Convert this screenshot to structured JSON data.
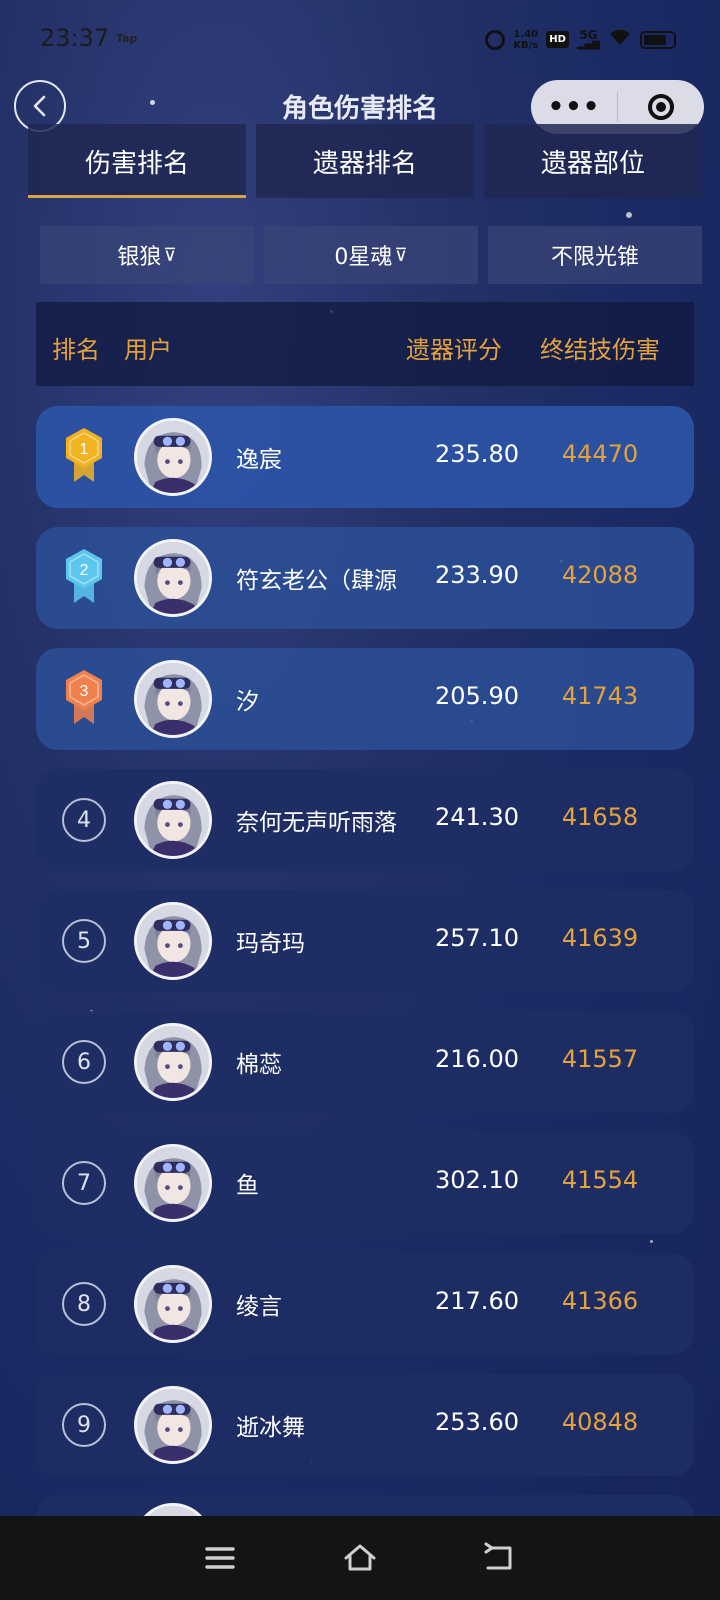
{
  "status_bar": {
    "time": "23:37",
    "tap_label": "Tap",
    "speed_value": "1.40",
    "speed_unit": "KB/s",
    "hd_label": "HD",
    "network_label": "5G"
  },
  "header": {
    "title": "角色伤害排名",
    "capsule_more": "•••"
  },
  "tabs": [
    {
      "label": "伤害排名",
      "active": true
    },
    {
      "label": "遗器排名",
      "active": false
    },
    {
      "label": "遗器部位",
      "active": false
    }
  ],
  "filters": {
    "character": "银狼",
    "eidolon": "0星魂",
    "lightcone": "不限光锥",
    "funnel_glyph": "⊽"
  },
  "table_header": {
    "rank": "排名",
    "user": "用户",
    "relic_score": "遗器评分",
    "ult_damage": "终结技伤害"
  },
  "rows": [
    {
      "rank": "1",
      "name": "逸宸",
      "score": "235.80",
      "damage": "44470"
    },
    {
      "rank": "2",
      "name": "符玄老公（肆源",
      "score": "233.90",
      "damage": "42088"
    },
    {
      "rank": "3",
      "name": "汐",
      "score": "205.90",
      "damage": "41743"
    },
    {
      "rank": "4",
      "name": "奈何无声听雨落",
      "score": "241.30",
      "damage": "41658"
    },
    {
      "rank": "5",
      "name": "玛奇玛",
      "score": "257.10",
      "damage": "41639"
    },
    {
      "rank": "6",
      "name": "棉蕊",
      "score": "216.00",
      "damage": "41557"
    },
    {
      "rank": "7",
      "name": "鱼",
      "score": "302.10",
      "damage": "41554"
    },
    {
      "rank": "8",
      "name": "绫言",
      "score": "217.60",
      "damage": "41366"
    },
    {
      "rank": "9",
      "name": "逝冰舞",
      "score": "253.60",
      "damage": "40848"
    }
  ],
  "colors": {
    "accent_gold": "#e5a23b",
    "medal_gold": "#f2b322",
    "medal_silver_blue": "#5cc6ee",
    "medal_bronze": "#f0804c",
    "background": "#1b2a63"
  }
}
